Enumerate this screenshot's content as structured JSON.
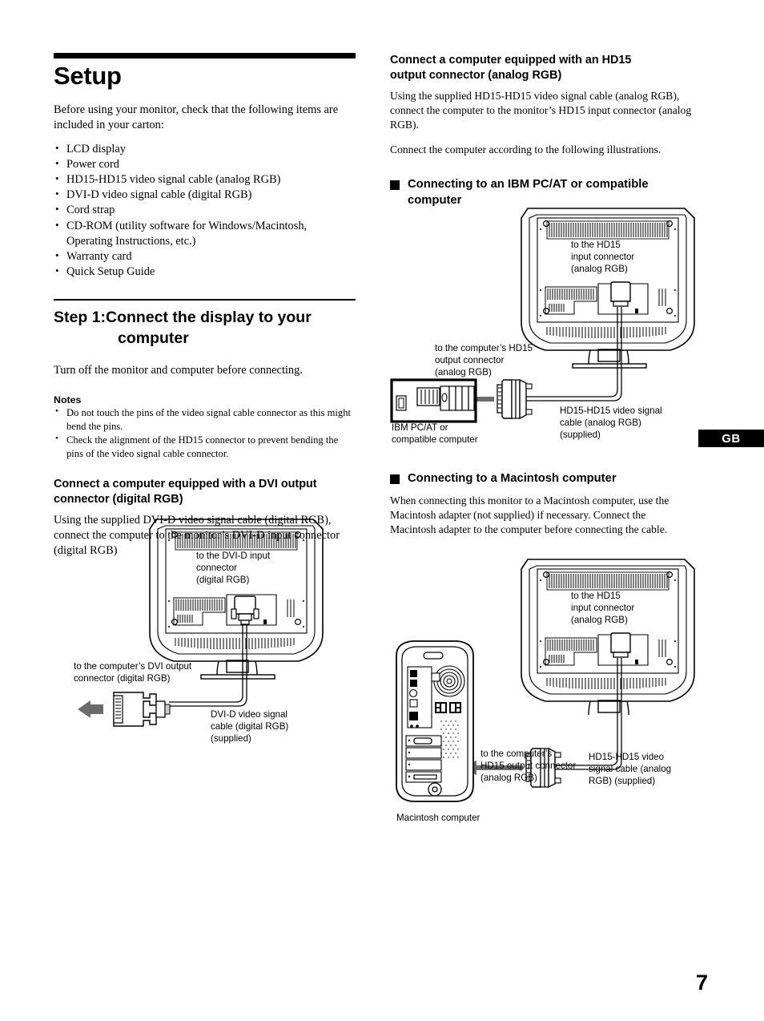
{
  "page": {
    "number": "7",
    "locale_tab": "GB"
  },
  "left": {
    "title": "Setup",
    "intro": "Before using your monitor, check that the following items are included in your carton:",
    "carton_items": [
      "LCD display",
      "Power cord",
      "HD15-HD15 video signal cable (analog RGB)",
      "DVI-D video signal cable (digital RGB)",
      "Cord strap",
      "CD-ROM (utility software for Windows/Macintosh, Operating Instructions, etc.)",
      "Warranty card",
      "Quick Setup Guide"
    ],
    "step_label": "Step 1:",
    "step_title_line1": "Connect the display to your",
    "step_title_line2": "computer",
    "step_intro": "Turn off the monitor and computer before connecting.",
    "notes_heading": "Notes",
    "notes": [
      "Do not touch the pins of the video signal cable connector as this might bend the pins.",
      "Check the alignment of the HD15 connector to prevent bending the pins of the video signal cable connector."
    ],
    "dvi_subhead_line1": "Connect a computer equipped with a DVI output",
    "dvi_subhead_line2": "connector (digital RGB)",
    "dvi_body": "Using the supplied DVI-D video signal cable (digital RGB), connect the computer to the monitor’s DVI-D input connector (digital RGB)",
    "figure_dvi": {
      "monitor_label": "to the DVI-D input\nconnector\n(digital RGB)",
      "computer_label": "to the computer’s DVI output\nconnector (digital RGB)",
      "cable_label": "DVI-D video signal\ncable (digital RGB)\n(supplied)"
    }
  },
  "right": {
    "hd15_subhead_line1": "Connect a computer equipped with an HD15",
    "hd15_subhead_line2": "output connector (analog RGB)",
    "hd15_body": "Using the supplied HD15-HD15 video signal cable (analog RGB), connect the computer to the monitor’s HD15 input connector (analog RGB).",
    "hd15_body2": "Connect the computer according to the following illustrations.",
    "ibm_head_line1": "Connecting to an IBM PC/AT or compatible",
    "ibm_head_line2": "computer",
    "figure_ibm": {
      "monitor_label": "to the HD15\ninput connector\n(analog RGB)",
      "computer_label": "to the computer’s HD15\noutput connector\n(analog RGB)",
      "computer_name": "IBM PC/AT or\ncompatible computer",
      "cable_label": "HD15-HD15 video signal\ncable (analog RGB)\n(supplied)"
    },
    "mac_head": "Connecting to a Macintosh computer",
    "mac_body": "When connecting this monitor to a Macintosh computer, use the Macintosh adapter (not supplied) if necessary. Connect the Macintosh adapter to the computer before connecting the cable.",
    "figure_mac": {
      "monitor_label": "to the HD15\ninput connector\n(analog RGB)",
      "computer_label": "to the computer’s\nHD15 output connector\n(analog RGB)",
      "computer_name": "Macintosh computer",
      "cable_label": "HD15-HD15 video\nsignal cable (analog\nRGB) (supplied)"
    }
  }
}
